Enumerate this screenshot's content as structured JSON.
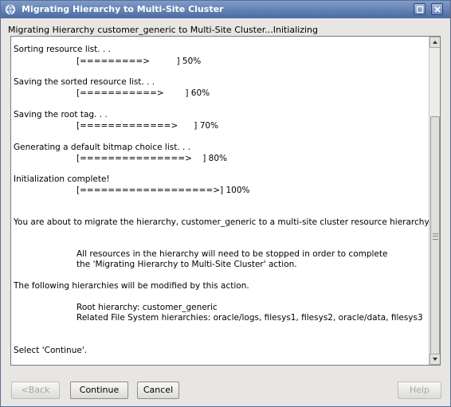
{
  "window": {
    "title": "Migrating Hierarchy to Multi-Site Cluster"
  },
  "header": {
    "status": "Migrating Hierarchy customer_generic to Multi-Site Cluster...Initializing"
  },
  "log": {
    "steps": [
      {
        "label": "Sorting resource list. . .",
        "bar": "[=========>          ] 50%"
      },
      {
        "label": "Saving the sorted resource list. . .",
        "bar": "[===========>        ] 60%"
      },
      {
        "label": "Saving the root tag. . .",
        "bar": "[=============>      ] 70%"
      },
      {
        "label": "Generating a default bitmap choice list. . .",
        "bar": "[===============>    ] 80%"
      },
      {
        "label": "Initialization complete!",
        "bar": "[===================>] 100%"
      }
    ],
    "migrate_notice": "You are about to migrate the hierarchy, customer_generic to a multi-site cluster resource hierarchy.",
    "stop_notice_1": "All resources in the hierarchy will need to be stopped in order to complete",
    "stop_notice_2": "the 'Migrating Hierarchy to Multi-Site Cluster' action.",
    "modified_notice": "The following hierarchies will be modified by this action.",
    "root_hierarchy": "Root hierarchy: customer_generic",
    "related_fs": "Related File System hierarchies: oracle/logs, filesys1, filesys2, oracle/data, filesys3",
    "select_continue": "Select 'Continue'."
  },
  "buttons": {
    "back": "<Back",
    "continue": "Continue",
    "cancel": "Cancel",
    "help": "Help"
  },
  "icons": {
    "app": "app-globe-icon",
    "restore": "restore-window-icon",
    "close": "close-window-icon",
    "scroll_up": "arrow-up-icon",
    "scroll_down": "arrow-down-icon"
  },
  "colors": {
    "titlebar": "#4a6aa1",
    "window_bg": "#e8e6e3",
    "panel_bg": "#ffffff",
    "disabled_text": "#a6a6a6"
  }
}
